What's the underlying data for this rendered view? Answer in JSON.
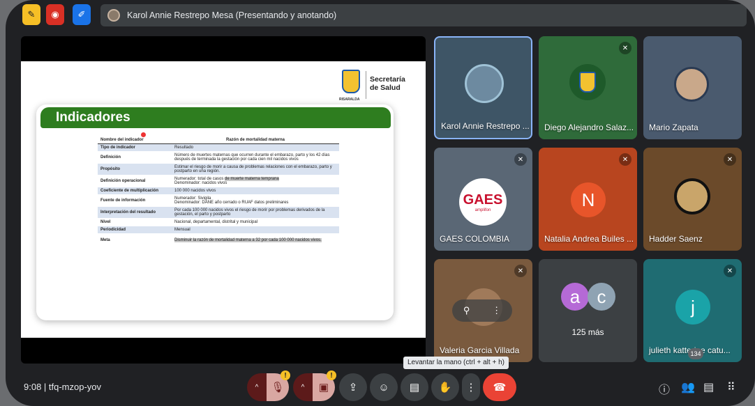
{
  "topbar": {
    "presenter_text": "Karol Annie Restrepo Mesa (Presentando y anotando)"
  },
  "slide": {
    "title": "Indicadores",
    "org_line1": "Secretaría",
    "org_line2": "de Salud",
    "crest_caption": "RISARALDA",
    "table_header": {
      "key": "Nombre del indicador",
      "value": "Razón de mortalidad materna"
    },
    "rows": [
      {
        "key": "Tipo de indicador",
        "value": "Resultado"
      },
      {
        "key": "Definición",
        "value": "Número de muertes maternas que ocurren durante el embarazo, parto y los 42 días después de terminada la gestación por cada cien mil nacidos vivos"
      },
      {
        "key": "Propósito",
        "value": "Estimar el riesgo de morir a causa de problemas relaciones con el embarazo, parto y postparto en una región."
      },
      {
        "key": "Definición operacional",
        "value_a": "Numerador: total de casos ",
        "value_hl": "de muerte materna temprana",
        "value_b": "Denominador: nacidos vivos"
      },
      {
        "key": "Coeficiente de multiplicación",
        "value": "100 000 nacidos vivos"
      },
      {
        "key": "Fuente de información",
        "value_a": "Numerador: Sivigila",
        "value_b": "Denominador: DANE año cerrado o RUAF datos preliminares"
      },
      {
        "key": "Interpretación del resultado",
        "value": "Por cada 100 000 nacidos vivos el riesgo de morir por problemas derivados de la gestación, el parto y postparto"
      },
      {
        "key": "Nivel",
        "value": "Nacional, departamental, distrital y municipal"
      },
      {
        "key": "Periodicidad",
        "value": "Mensual"
      },
      {
        "key": "Meta",
        "value": "Disminuir la razón de mortalidad materna a 32 por cada 100 000 nacidos vivos."
      }
    ]
  },
  "participants": [
    {
      "name": "Karol Annie Restrepo ...",
      "bg": "#3e5566"
    },
    {
      "name": "Diego Alejandro Salaz...",
      "bg": "#2f6b3a"
    },
    {
      "name": "Mario Zapata",
      "bg": "#4a5a6e"
    },
    {
      "name": "GAES COLOMBIA",
      "bg": "#5a6775",
      "logo": "GAES",
      "logo_sub": "amplifon"
    },
    {
      "name": "Natalia Andrea Builes ...",
      "bg": "#b8451f",
      "initial": "N",
      "initial_color": "#e8552a"
    },
    {
      "name": "Hadder Saenz",
      "bg": "#6b4a2a"
    },
    {
      "name": "Valeria Garcia Villada",
      "bg": "#7a5a3e"
    },
    {
      "name": "125 más",
      "bg": "#3c4043",
      "a1": "a",
      "a2": "c"
    },
    {
      "name": "julieth katterine catu...",
      "bg": "#1f6c72",
      "initial": "j",
      "initial_color": "#1aa3a8"
    }
  ],
  "bottombar": {
    "time_code": "9:08  |  tfq-mzop-yov",
    "tooltip": "Levantar la mano (ctrl + alt + h)",
    "participants_count": "134"
  },
  "colors": {
    "accent_red": "#ea4335",
    "slide_green": "#2e7d1f"
  }
}
